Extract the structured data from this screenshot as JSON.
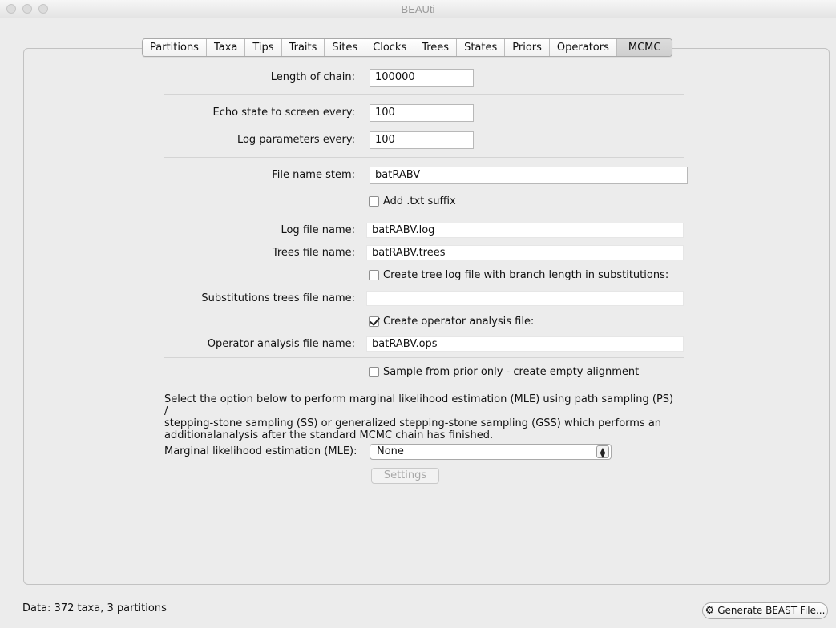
{
  "window": {
    "title": "BEAUti"
  },
  "tabs": [
    {
      "label": "Partitions"
    },
    {
      "label": "Taxa"
    },
    {
      "label": "Tips"
    },
    {
      "label": "Traits"
    },
    {
      "label": "Sites"
    },
    {
      "label": "Clocks"
    },
    {
      "label": "Trees"
    },
    {
      "label": "States"
    },
    {
      "label": "Priors"
    },
    {
      "label": "Operators"
    },
    {
      "label": "MCMC"
    }
  ],
  "active_tab": "MCMC",
  "mcmc": {
    "length_label": "Length of chain:",
    "length_value": "100000",
    "echo_label": "Echo state to screen every:",
    "echo_value": "100",
    "log_params_label": "Log parameters every:",
    "log_params_value": "100",
    "stem_label": "File name stem:",
    "stem_value": "batRABV",
    "add_txt_label": "Add .txt suffix",
    "log_file_label": "Log file name:",
    "log_file_value": "batRABV.log",
    "trees_file_label": "Trees file name:",
    "trees_file_value": "batRABV.trees",
    "create_tree_log_label": "Create tree log file with branch length in substitutions:",
    "subst_trees_label": "Substitutions trees file name:",
    "subst_trees_value": "",
    "create_operator_label": "Create operator analysis file:",
    "operator_file_label": "Operator analysis file name:",
    "operator_file_value": "batRABV.ops",
    "sample_prior_label": "Sample from prior only - create empty alignment",
    "mle_description_1": "Select the option below to perform marginal likelihood estimation (MLE) using path sampling (PS) /",
    "mle_description_2": "stepping-stone sampling (SS) or generalized stepping-stone sampling (GSS) which performs an",
    "mle_description_3": "additionalanalysis after the standard MCMC chain has finished.",
    "mle_label": "Marginal likelihood estimation (MLE):",
    "mle_value": "None",
    "settings_label": "Settings"
  },
  "checkboxes": {
    "add_txt": false,
    "create_tree_log": false,
    "create_operator": true,
    "sample_prior": false
  },
  "footer": {
    "status": "Data: 372 taxa, 3 partitions",
    "generate_label": "Generate BEAST File..."
  }
}
